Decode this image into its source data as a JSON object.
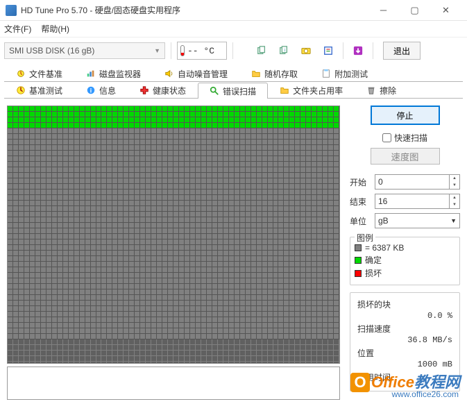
{
  "window": {
    "title": "HD Tune Pro 5.70 - 硬盘/固态硬盘实用程序"
  },
  "menu": {
    "file": "文件(F)",
    "help": "帮助(H)"
  },
  "toolbar": {
    "device": "SMI   USB DISK (16 gB)",
    "temp": "-- °C",
    "exit": "退出"
  },
  "tabs_top": [
    {
      "id": "file-bench",
      "label": "文件基准",
      "icon": "⚡"
    },
    {
      "id": "disk-monitor",
      "label": "磁盘监视器",
      "icon": "📊"
    },
    {
      "id": "aam",
      "label": "自动噪音管理",
      "icon": "🔊"
    },
    {
      "id": "random-access",
      "label": "随机存取",
      "icon": "📁"
    },
    {
      "id": "extra-tests",
      "label": "附加测试",
      "icon": "📋"
    }
  ],
  "tabs_bottom": [
    {
      "id": "benchmark",
      "label": "基准测试",
      "icon": "📈"
    },
    {
      "id": "info",
      "label": "信息",
      "icon": "ℹ"
    },
    {
      "id": "health",
      "label": "健康状态",
      "icon": "✚"
    },
    {
      "id": "error-scan",
      "label": "错误扫描",
      "icon": "🔍"
    },
    {
      "id": "folder-usage",
      "label": "文件夹占用率",
      "icon": "📂"
    },
    {
      "id": "erase",
      "label": "擦除",
      "icon": "🗑"
    }
  ],
  "controls": {
    "stop": "停止",
    "quick_scan": "快速扫描",
    "speed_map": "速度图",
    "start_label": "开始",
    "start_value": "0",
    "end_label": "结束",
    "end_value": "16",
    "unit_label": "单位",
    "unit_value": "gB"
  },
  "legend": {
    "title": "图例",
    "block_size": "= 6387 KB",
    "ok": "确定",
    "damaged": "损坏"
  },
  "stats": {
    "damaged_label": "损坏的块",
    "damaged_value": "0.0 %",
    "speed_label": "扫描速度",
    "speed_value": "36.8 MB/s",
    "position_label": "位置",
    "position_value": "1000 mB",
    "elapsed_label": "已用时间",
    "elapsed_value": ""
  },
  "chart_data": {
    "type": "heatmap",
    "cols": 60,
    "rows": 47,
    "ok_rows": 4,
    "ok_extra_cells": 0,
    "legend": {
      "ok": "#00d900",
      "pending": "#808080",
      "damaged": "#ff0000"
    },
    "block_size_kb": 6387
  },
  "watermark": {
    "brand1": "Office",
    "brand2": "教程网",
    "url": "www.office26.com"
  }
}
